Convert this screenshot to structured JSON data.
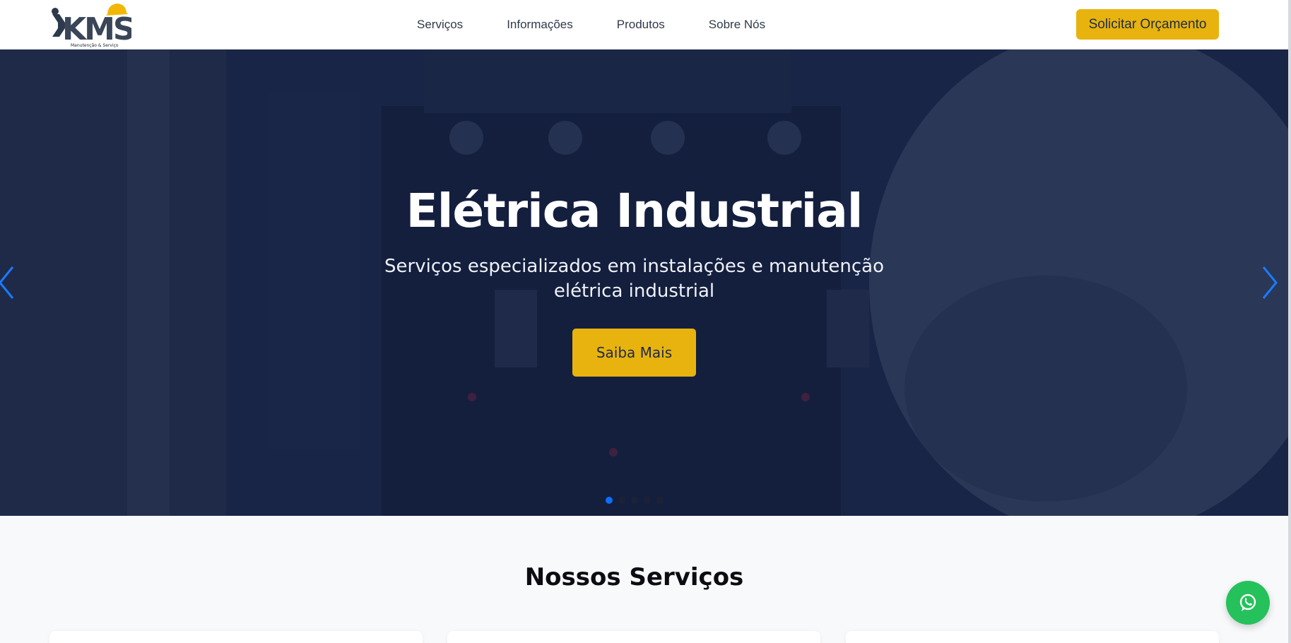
{
  "header": {
    "logo_alt": "KMS Manutenção & Serviço",
    "logo_text": "KMS",
    "logo_tagline": "Manutenção & Serviço",
    "nav": [
      {
        "label": "Serviços"
      },
      {
        "label": "Informações"
      },
      {
        "label": "Produtos"
      },
      {
        "label": "Sobre Nós"
      }
    ],
    "cta_label": "Solicitar Orçamento"
  },
  "hero": {
    "title": "Elétrica Industrial",
    "subtitle": "Serviços especializados em instalações e manutenção elétrica industrial",
    "button_label": "Saiba Mais",
    "slides_total": 5,
    "active_slide": 1
  },
  "services": {
    "title": "Nossos Serviços"
  },
  "colors": {
    "accent": "#e8b30e",
    "hero_overlay": "#0e1c42",
    "carousel_active": "#0d6efd",
    "whatsapp": "#25c15b"
  },
  "icons": {
    "prev": "chevron-left-icon",
    "next": "chevron-right-icon",
    "whatsapp": "whatsapp-icon"
  }
}
